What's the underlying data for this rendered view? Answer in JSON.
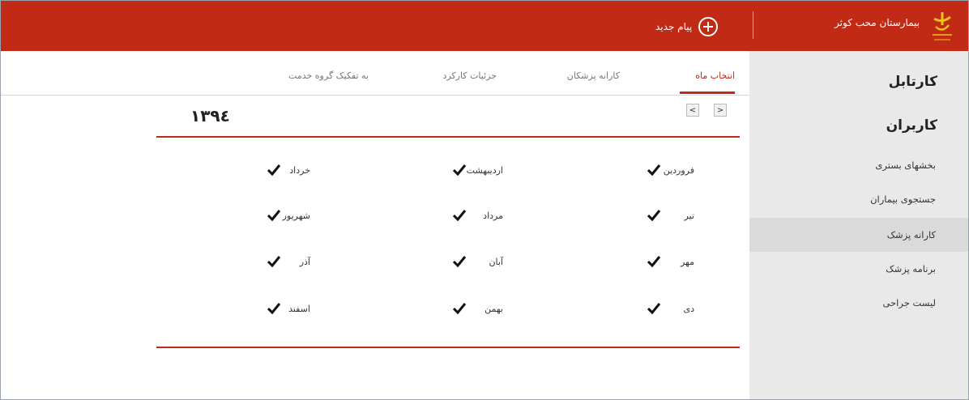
{
  "header": {
    "hospital_name": "بیمارستان محب کوثر",
    "new_message_label": "پیام جدید",
    "background_color": "#c12a14"
  },
  "sidebar": {
    "heading1": "کارتابل",
    "heading2": "کاربران",
    "items": [
      {
        "label": "بخشهای بستری",
        "active": false
      },
      {
        "label": "جستجوی بیماران",
        "active": false
      },
      {
        "label": "کارانه پزشک",
        "active": true
      },
      {
        "label": "برنامه پزشک",
        "active": false
      },
      {
        "label": "لیست جراحی",
        "active": false
      }
    ]
  },
  "tabs": [
    {
      "label": "انتخاب ماه",
      "active": true
    },
    {
      "label": "کارانه پزشکان",
      "active": false
    },
    {
      "label": "جزئیات کارکرد",
      "active": false
    },
    {
      "label": "به تفکیک گروه خدمت",
      "active": false
    }
  ],
  "year_nav": {
    "prev_label": "<",
    "next_label": ">",
    "year": "۱۳۹٤"
  },
  "months": [
    {
      "name": "فروردین",
      "checked": true
    },
    {
      "name": "اردیبهشت",
      "checked": true
    },
    {
      "name": "خرداد",
      "checked": true
    },
    {
      "name": "تیر",
      "checked": true
    },
    {
      "name": "مرداد",
      "checked": true
    },
    {
      "name": "شهریور",
      "checked": true
    },
    {
      "name": "مهر",
      "checked": true
    },
    {
      "name": "آبان",
      "checked": true
    },
    {
      "name": "آذر",
      "checked": true
    },
    {
      "name": "دی",
      "checked": true
    },
    {
      "name": "بهمن",
      "checked": true
    },
    {
      "name": "اسفند",
      "checked": true
    }
  ],
  "accent_color": "#c12a14"
}
